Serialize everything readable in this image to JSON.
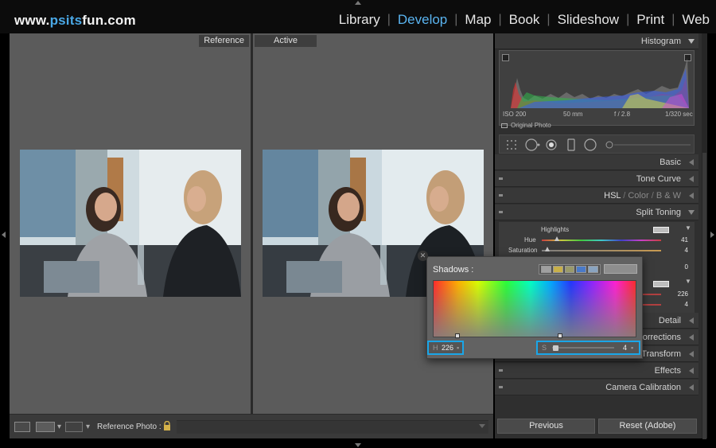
{
  "branding": {
    "site_name_prefix": "www.",
    "site_name_accent": "psits",
    "site_name_suffix": "fun.com"
  },
  "modules": [
    {
      "label": "Library",
      "active": false
    },
    {
      "label": "Develop",
      "active": true
    },
    {
      "label": "Map",
      "active": false
    },
    {
      "label": "Book",
      "active": false
    },
    {
      "label": "Slideshow",
      "active": false
    },
    {
      "label": "Print",
      "active": false
    },
    {
      "label": "Web",
      "active": false
    }
  ],
  "compare": {
    "left_label": "Reference",
    "right_label": "Active"
  },
  "toolbar": {
    "reference_photo_label": "Reference Photo :"
  },
  "histogram": {
    "title": "Histogram",
    "iso": "ISO 200",
    "focal_length": "50 mm",
    "aperture": "f / 2.8",
    "shutter": "1/320 sec",
    "original_photo_label": "Original Photo"
  },
  "panels": {
    "basic": "Basic",
    "tone_curve": "Tone Curve",
    "hsl": "HSL",
    "hsl_sep": "/",
    "color": "Color",
    "bw": "B & W",
    "split_toning": "Split Toning",
    "detail": "Detail",
    "lens_corrections": "Lens Corrections",
    "transform": "Transform",
    "effects": "Effects",
    "camera_calibration": "Camera Calibration"
  },
  "split_toning": {
    "highlights_label": "Highlights",
    "hue_label": "Hue",
    "hue_value": "41",
    "saturation_label": "Saturation",
    "saturation_value": "4",
    "balance_value": "0",
    "shadows_hue_value": "226",
    "shadows_sat_value": "4"
  },
  "popup": {
    "title": "Shadows :",
    "h_letter": "H",
    "h_value": "226",
    "s_letter": "S",
    "s_value": "4",
    "preset_colors": [
      "#a0a0a0",
      "#c8b04a",
      "#9a9a6a",
      "#4a7ac8",
      "#8aa4c0"
    ]
  },
  "buttons": {
    "previous": "Previous",
    "reset": "Reset (Adobe)"
  }
}
